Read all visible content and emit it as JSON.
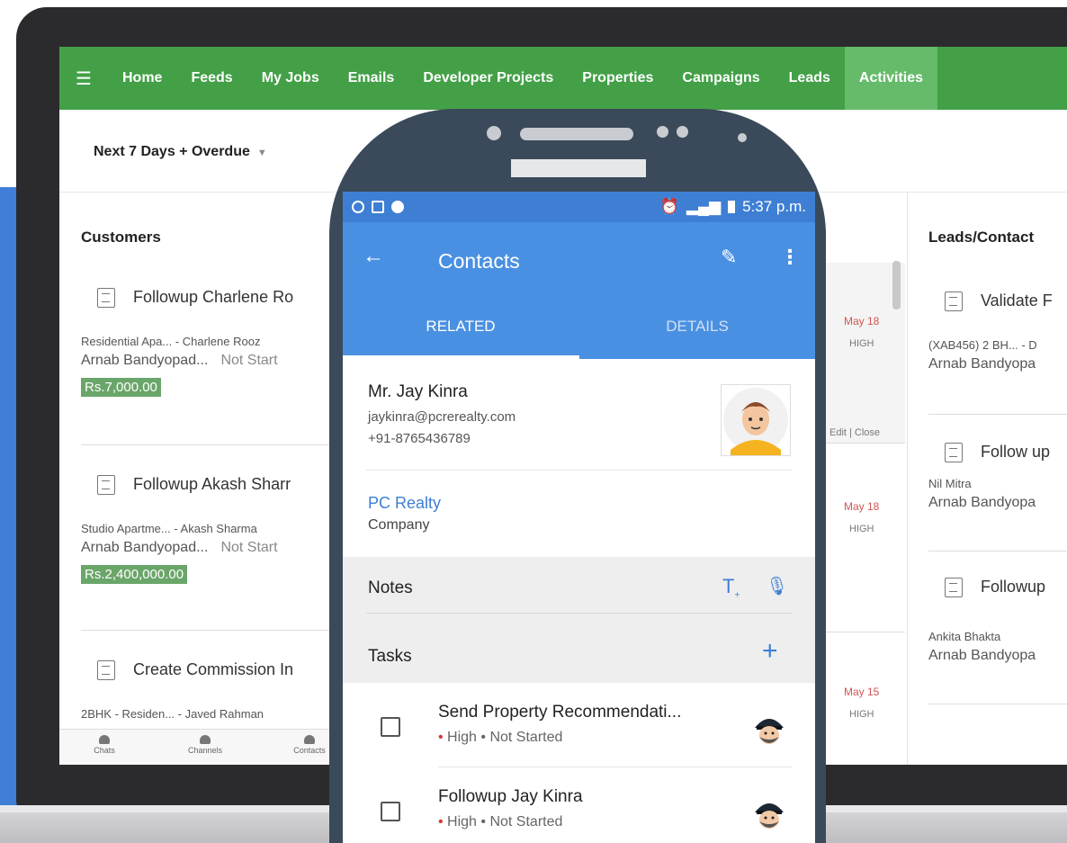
{
  "nav": {
    "items": [
      "Home",
      "Feeds",
      "My Jobs",
      "Emails",
      "Developer Projects",
      "Properties",
      "Campaigns",
      "Leads",
      "Activities"
    ]
  },
  "filter": {
    "label": "Next 7 Days + Overdue"
  },
  "customers": {
    "title": "Customers",
    "cards": [
      {
        "title": "Followup Charlene Ro",
        "sub": "Residential Apa... - Charlene Rooz",
        "owner": "Arnab Bandyopad...",
        "status": "Not Start",
        "amount": "Rs.7,000.00"
      },
      {
        "title": "Followup Akash Sharr",
        "sub": "Studio Apartme... - Akash Sharma",
        "owner": "Arnab Bandyopad...",
        "status": "Not Start",
        "amount": "Rs.2,400,000.00"
      },
      {
        "title": "Create Commission In",
        "sub": "2BHK - Residen... - Javed Rahman",
        "owner": "",
        "status": "",
        "amount": ""
      }
    ]
  },
  "middle": {
    "rows": [
      {
        "date": "May 18",
        "prio": "HIGH"
      },
      {
        "date": "May 18",
        "prio": "HIGH"
      },
      {
        "date": "May 15",
        "prio": "HIGH"
      }
    ],
    "edit_close": "Edit | Close"
  },
  "leads": {
    "title": "Leads/Contact",
    "cards": [
      {
        "title": "Validate F",
        "sub": "(XAB456) 2 BH... - D",
        "owner": "Arnab Bandyopa"
      },
      {
        "title": "Follow up",
        "sub": "Nil Mitra",
        "owner": "Arnab Bandyopa"
      },
      {
        "title": "Followup",
        "sub": "Ankita Bhakta",
        "owner": "Arnab Bandyopa"
      }
    ]
  },
  "bottombar": {
    "items": [
      "Chats",
      "Channels",
      "Contacts"
    ]
  },
  "phone": {
    "status_time": "5:37 p.m.",
    "appbar_title": "Contacts",
    "tabs": [
      "RELATED",
      "DETAILS"
    ],
    "contact": {
      "name": "Mr. Jay Kinra",
      "email": "jaykinra@pcrerealty.com",
      "phone": "+91-8765436789"
    },
    "company": {
      "name": "PC Realty",
      "label": "Company"
    },
    "notes_label": "Notes",
    "tasks_label": "Tasks",
    "tasks": [
      {
        "title": "Send Property Recommendati...",
        "priority": "High",
        "status": "Not Started"
      },
      {
        "title": "Followup Jay Kinra",
        "priority": "High",
        "status": "Not Started"
      }
    ]
  },
  "colors": {
    "nav_green": "#43a047",
    "active_green": "#66bb6a",
    "phone_blue": "#4a90e2",
    "amount_green": "#6aa56a",
    "date_red": "#d35454"
  }
}
